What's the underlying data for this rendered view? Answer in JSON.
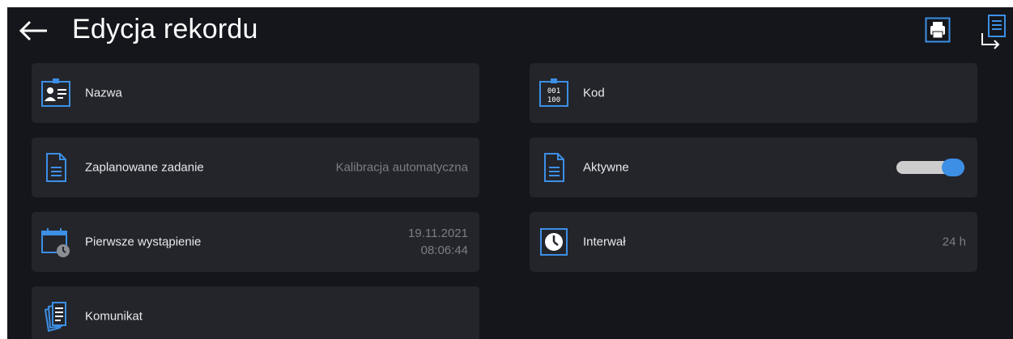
{
  "header": {
    "title": "Edycja rekordu",
    "icons": {
      "back": "arrow-left-icon",
      "print": "printer-icon",
      "export": "document-export-icon"
    }
  },
  "fields": [
    {
      "label": "Nazwa",
      "value": "",
      "icon": "id-card-icon"
    },
    {
      "label": "Kod",
      "value": "",
      "icon": "code-calendar-icon"
    },
    {
      "label": "Zaplanowane zadanie",
      "value": "Kalibracja automatyczna",
      "icon": "document-icon"
    },
    {
      "label": "Aktywne",
      "value": "",
      "icon": "document-icon",
      "toggle_on": true
    },
    {
      "label": "Pierwsze wystąpienie",
      "value_date": "19.11.2021",
      "value_time": "08:06:44",
      "icon": "calendar-clock-icon"
    },
    {
      "label": "Interwał",
      "value": "24 h",
      "icon": "clock-icon"
    },
    {
      "label": "Komunikat",
      "value": "",
      "icon": "documents-stack-icon"
    }
  ],
  "colors": {
    "background": "#14161b",
    "tile": "#23252b",
    "accent": "#3d8fe6",
    "text": "#e9eaec",
    "value_text": "#7b7e86"
  }
}
